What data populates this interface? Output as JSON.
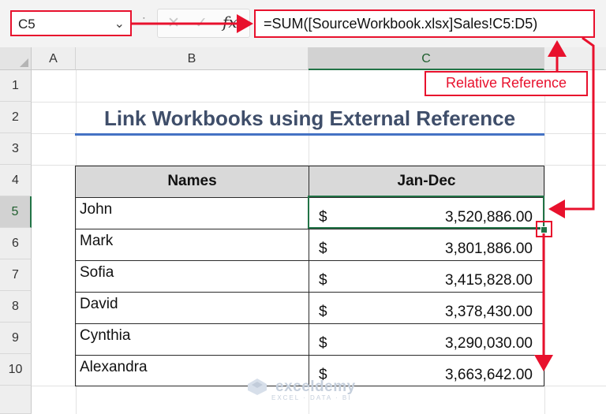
{
  "formula_bar": {
    "name_box": "C5",
    "name_box_chevron": "chevron-down-icon",
    "colon": ":",
    "cancel_glyph": "✕",
    "enter_glyph": "✓",
    "fx_glyph": "fx",
    "formula": "=SUM([SourceWorkbook.xlsx]Sales!C5:D5)"
  },
  "grid": {
    "columns": [
      "A",
      "B",
      "C"
    ],
    "rows": [
      "1",
      "2",
      "3",
      "4",
      "5",
      "6",
      "7",
      "8",
      "9",
      "10"
    ],
    "selected_column": "C",
    "selected_row": "5"
  },
  "title": "Link Workbooks using External Reference",
  "table": {
    "headers": [
      "Names",
      "Jan-Dec"
    ],
    "currency_symbol": "$",
    "rows": [
      {
        "name": "John",
        "amount": "3,520,886.00"
      },
      {
        "name": "Mark",
        "amount": "3,801,886.00"
      },
      {
        "name": "Sofia",
        "amount": "3,415,828.00"
      },
      {
        "name": "David",
        "amount": "3,378,430.00"
      },
      {
        "name": "Cynthia",
        "amount": "3,290,030.00"
      },
      {
        "name": "Alexandra",
        "amount": "3,663,642.00"
      }
    ]
  },
  "annotation": {
    "label": "Relative Reference",
    "color": "#e8112d"
  },
  "watermark": {
    "name": "exceldemy",
    "tagline": "EXCEL · DATA · BI"
  }
}
